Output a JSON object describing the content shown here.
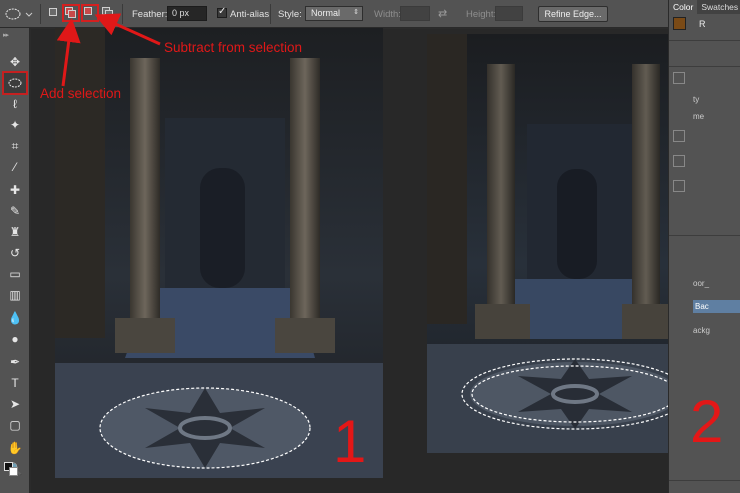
{
  "options_bar": {
    "feather_label": "Feather:",
    "feather_value": "0 px",
    "antialias_label": "Anti-alias",
    "style_label": "Style:",
    "style_value": "Normal",
    "width_label": "Width:",
    "height_label": "Height:",
    "refine_label": "Refine Edge..."
  },
  "panel": {
    "tab_color": "Color",
    "tab_swatches": "Swatches",
    "channel_r": "R",
    "frag_1": "ty",
    "frag_2": "me",
    "frag_3": "oor_",
    "frag_4": "Bac",
    "frag_5": "ackg"
  },
  "annotations": {
    "add_selection": "Add selection",
    "subtract_selection": "Subtract from selection",
    "num_1": "1",
    "num_2": "2"
  },
  "colors": {
    "accent_red": "#e01818",
    "foreground_swatch": "#7a4a16",
    "panel_bg": "#535353"
  }
}
